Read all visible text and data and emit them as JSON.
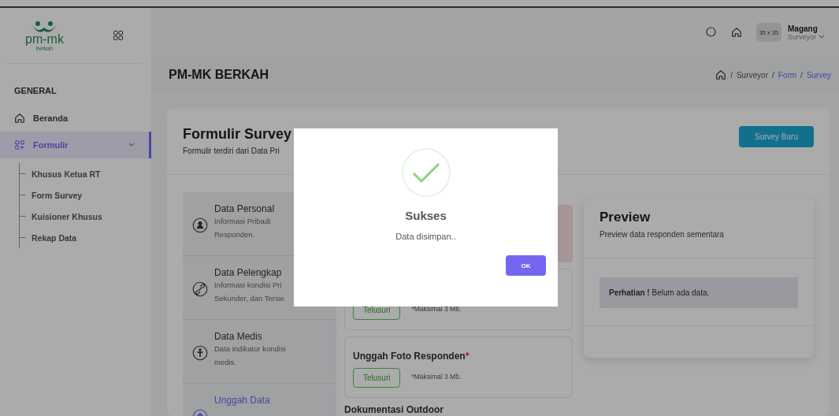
{
  "sidebar": {
    "logo": {
      "text": "pm-mk",
      "tagline": "berkah"
    },
    "section": "GENERAL",
    "items": [
      {
        "label": "Beranda",
        "selected": false
      },
      {
        "label": "Formulir",
        "selected": true,
        "expanded": true,
        "children": [
          {
            "label": "Khusus Ketua RT"
          },
          {
            "label": "Form Survey"
          },
          {
            "label": "Kuisioner Khusus"
          },
          {
            "label": "Rekap Data"
          }
        ]
      }
    ]
  },
  "topbar": {
    "avatar_text": "35 x 35",
    "user_name": "Magang",
    "user_role": "Surveyor"
  },
  "page_header": {
    "title": "PM-MK BERKAH",
    "separator": "/",
    "breadcrumb": [
      {
        "label": "Surveyor",
        "selected": false
      },
      {
        "label": "Form",
        "selected": true
      },
      {
        "label": "Survey",
        "selected": true
      }
    ]
  },
  "form_card": {
    "title": "Formulir Survey",
    "subtitle": "Formulir terdiri dari Data Pri",
    "button": "Survey Baru",
    "steps": [
      {
        "title": "Data Personal",
        "description": [
          "Informasi Pribadi",
          "Responden."
        ],
        "selected": false
      },
      {
        "title": "Data Pelengkap",
        "description": [
          "Informasi kondisi Pri",
          "Sekunder, dan Tersie"
        ],
        "selected": false
      },
      {
        "title": "Data Medis",
        "description": [
          "Data indikator kondisi",
          "medis."
        ],
        "selected": false
      },
      {
        "title": "Unggah Data",
        "selected": true
      }
    ],
    "uploads": [
      {
        "kind": "alert"
      },
      {
        "kind": "upload",
        "button": "Telusuri",
        "note": "*Maksimal 3 Mb."
      },
      {
        "kind": "upload",
        "title": "Unggah Foto Responden",
        "required_mark": "*",
        "button": "Telusuri",
        "note": "*Maksimal 3 Mb."
      },
      {
        "kind": "heading",
        "title": "Dokumentasi Outdoor"
      }
    ]
  },
  "preview": {
    "title": "Preview",
    "subtitle": "Preview data responden sementara",
    "notice": "**Perhatian !** Belum ada data."
  },
  "dialog": {
    "title": "Sukses",
    "message": "Data disimpan..",
    "button": "OK"
  }
}
